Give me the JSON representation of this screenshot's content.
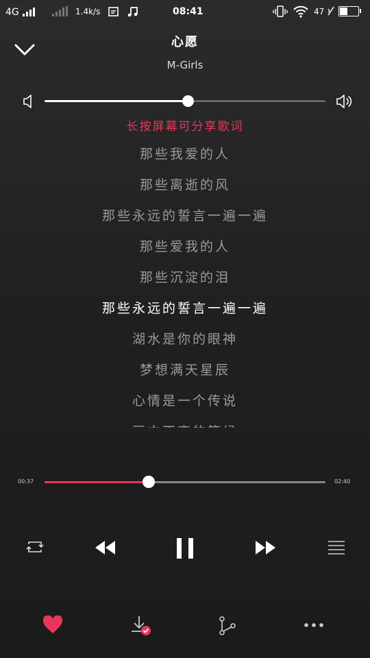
{
  "status_bar": {
    "network": "4G",
    "speed": "1.4k/s",
    "time": "08:41",
    "battery_percent": "47",
    "battery_level": 0.47,
    "icons": [
      "signal-icon",
      "signal-weak-icon",
      "screenshot-icon",
      "music-note-icon",
      "vibrate-icon",
      "wifi-icon",
      "battery-icon"
    ]
  },
  "song": {
    "title": "心愿",
    "artist": "M-Girls"
  },
  "volume": {
    "level": 0.51
  },
  "lyrics_hint": "长按屏幕可分享歌词",
  "lyrics": [
    "那些我爱的人",
    "那些离逝的风",
    "那些永远的誓言一遍一遍",
    "那些爱我的人",
    "那些沉淀的泪",
    "那些永远的誓言一遍一遍",
    "湖水是你的眼神",
    "梦想满天星辰",
    "心情是一个传说",
    "亘古不变的等候"
  ],
  "current_lyric_index": 5,
  "playback": {
    "current_time": "00:37",
    "total_time": "02:40",
    "progress": 0.37,
    "state": "playing"
  },
  "controls": [
    "repeat-icon",
    "previous-icon",
    "pause-icon",
    "next-icon",
    "playlist-icon"
  ],
  "bottom_actions": [
    "favorite-icon",
    "download-icon",
    "share-icon",
    "more-icon"
  ],
  "colors": {
    "accent": "#e8365c",
    "background": "#1c1c1c",
    "lyric_inactive": "#9a9a9a"
  }
}
